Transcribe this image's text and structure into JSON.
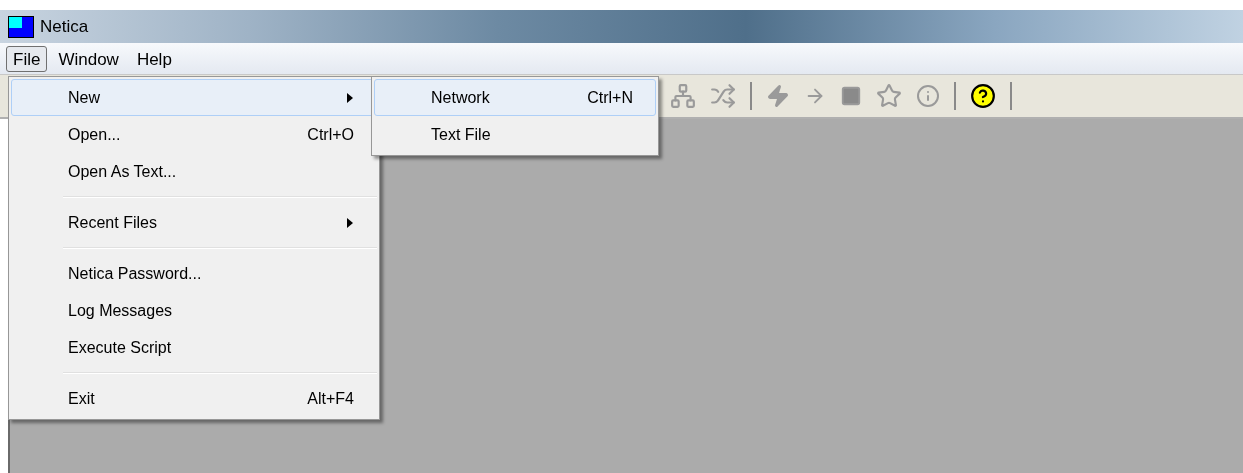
{
  "window": {
    "title": "Netica"
  },
  "menubar": [
    {
      "label": "File",
      "selected": true
    },
    {
      "label": "Window",
      "selected": false
    },
    {
      "label": "Help",
      "selected": false
    }
  ],
  "file_menu": [
    {
      "kind": "item",
      "label": "New",
      "submenu": true,
      "selected": true
    },
    {
      "kind": "item",
      "label": "Open...",
      "shortcut": "Ctrl+O",
      "submenu": false,
      "selected": false
    },
    {
      "kind": "item",
      "label": "Open As Text...",
      "submenu": false,
      "selected": false
    },
    {
      "kind": "separator"
    },
    {
      "kind": "item",
      "label": "Recent Files",
      "submenu": true,
      "selected": false
    },
    {
      "kind": "separator"
    },
    {
      "kind": "item",
      "label": "Netica Password...",
      "submenu": false,
      "selected": false
    },
    {
      "kind": "item",
      "label": "Log Messages",
      "submenu": false,
      "selected": false
    },
    {
      "kind": "item",
      "label": "Execute Script",
      "submenu": false,
      "selected": false
    },
    {
      "kind": "separator"
    },
    {
      "kind": "item",
      "label": "Exit",
      "shortcut": "Alt+F4",
      "submenu": false,
      "selected": false
    }
  ],
  "new_submenu": [
    {
      "kind": "item",
      "label": "Network",
      "shortcut": "Ctrl+N",
      "submenu": false,
      "selected": true
    },
    {
      "kind": "item",
      "label": "Text File",
      "submenu": false,
      "selected": false
    }
  ]
}
